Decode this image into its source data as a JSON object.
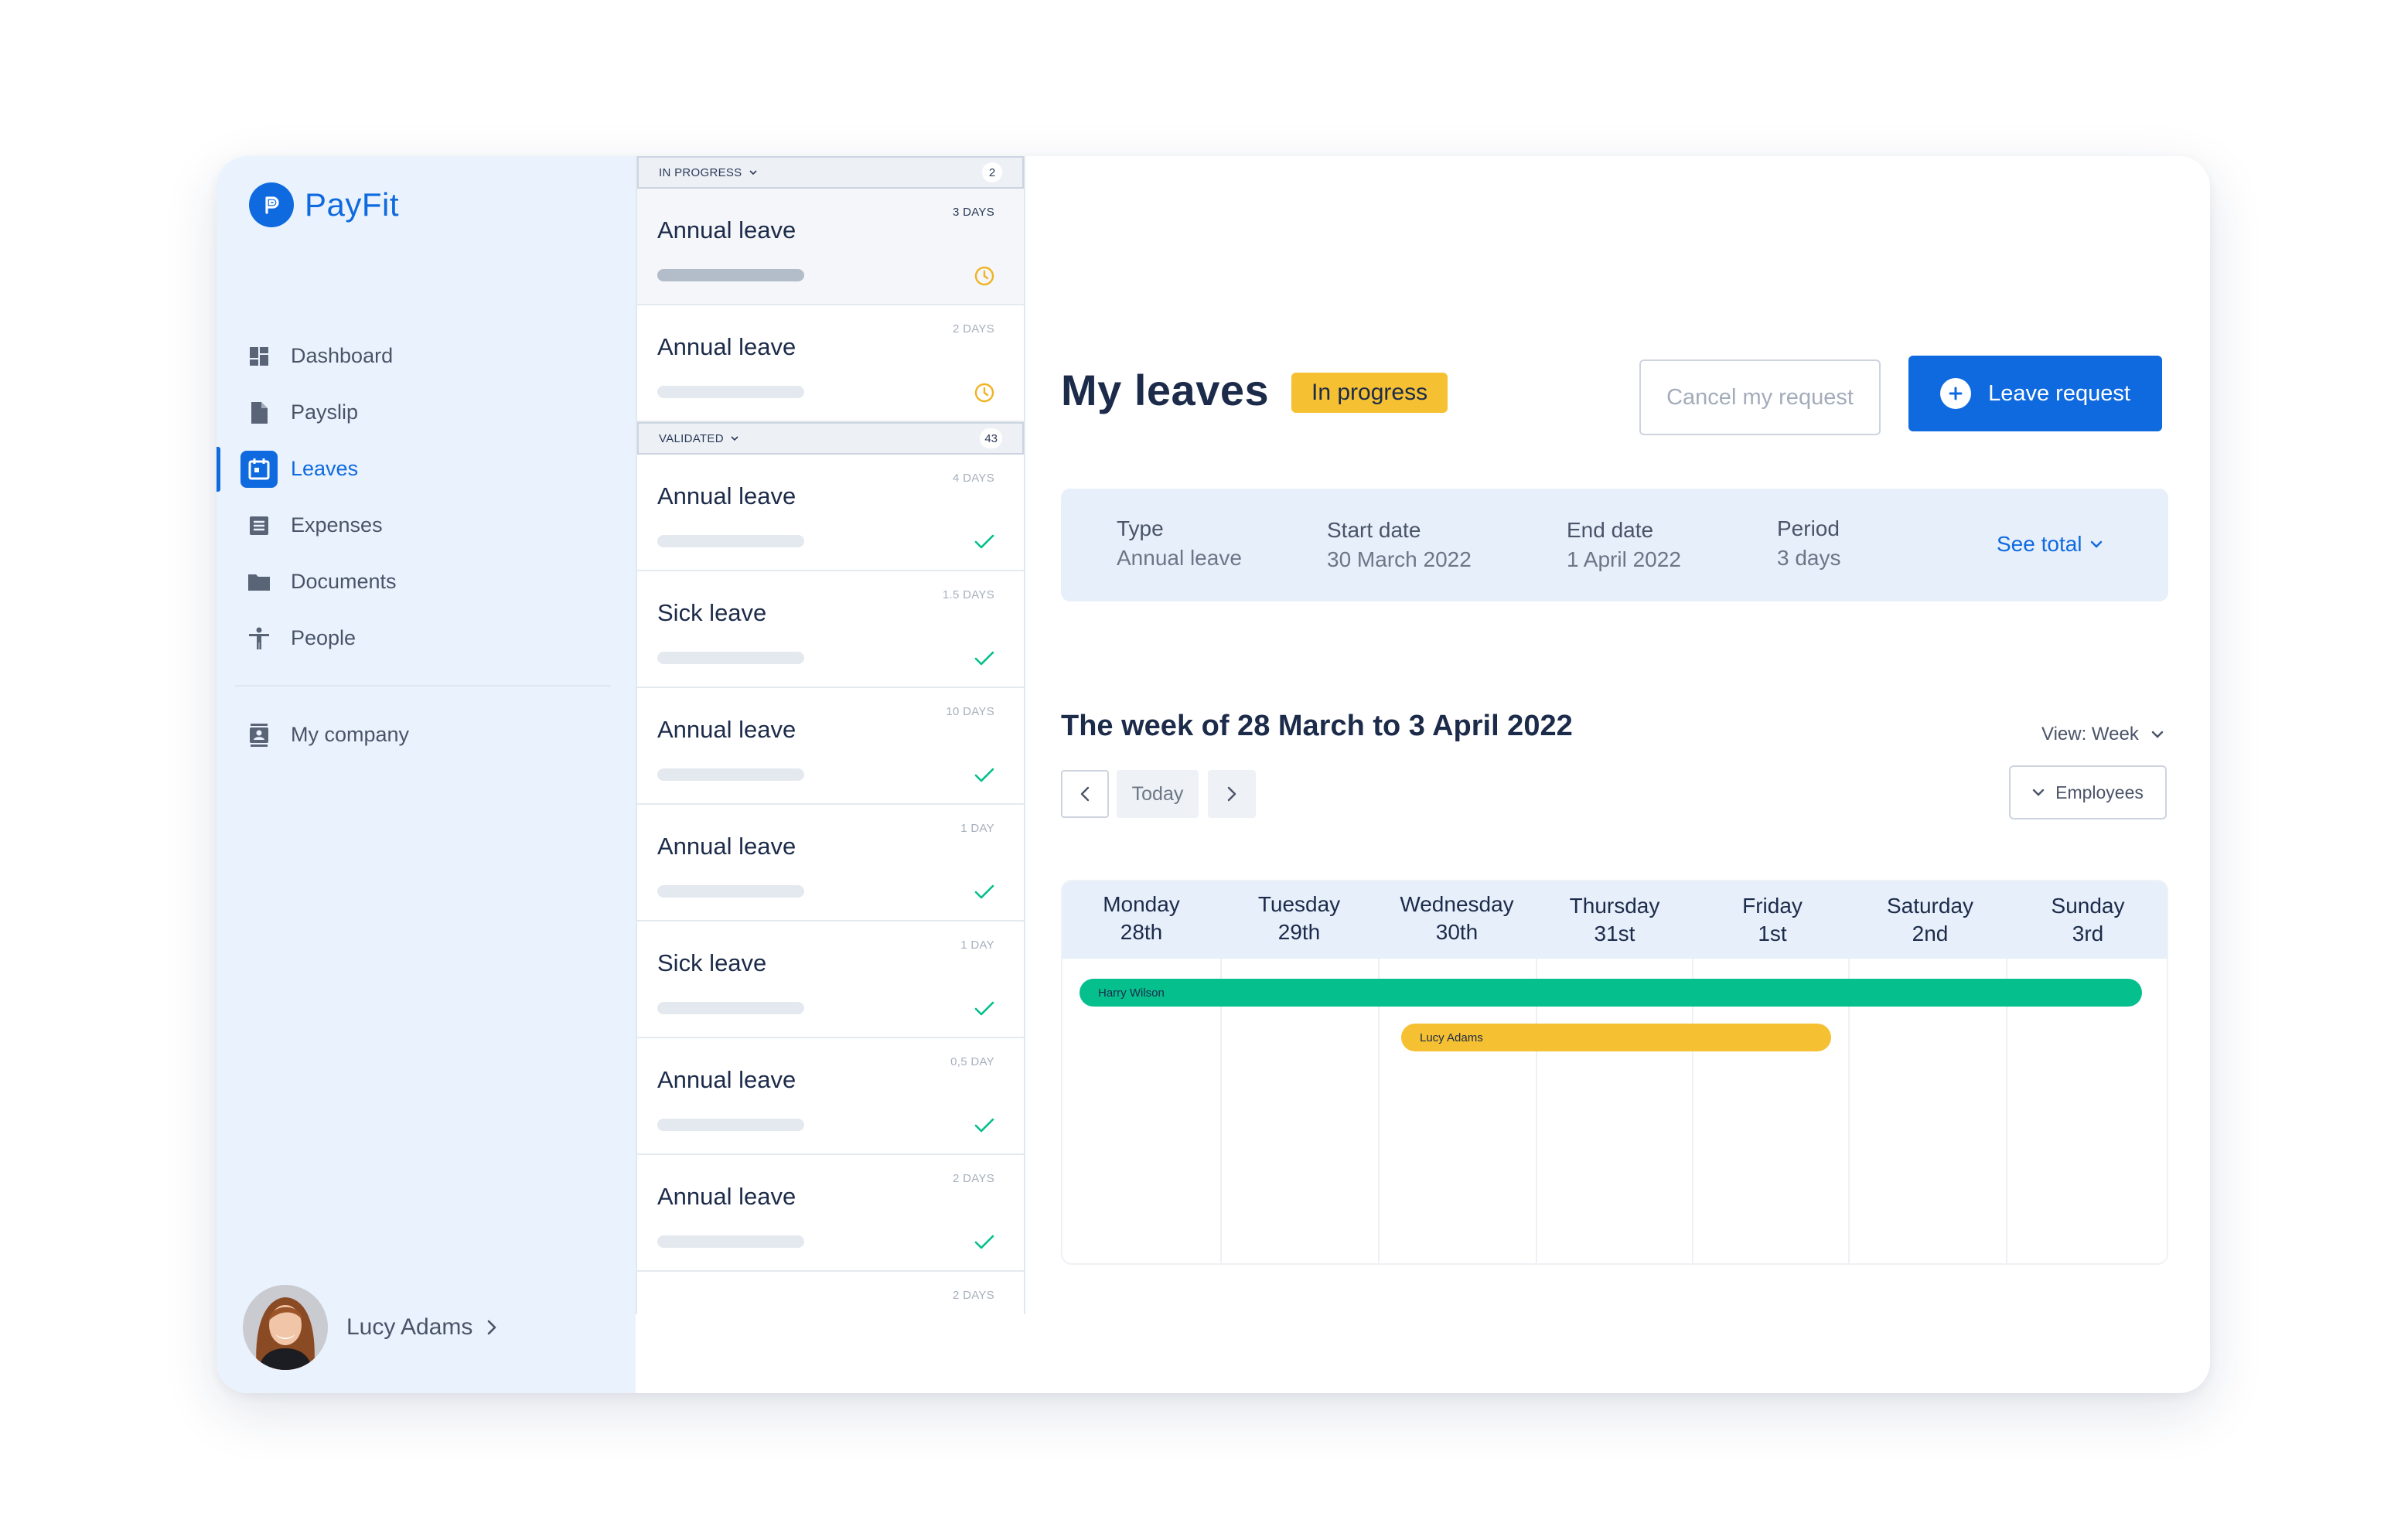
{
  "app": {
    "brand": "PayFit",
    "brand_color": "#0f6ae0"
  },
  "sidebar": {
    "items": [
      {
        "label": "Dashboard",
        "icon": "dashboard-icon"
      },
      {
        "label": "Payslip",
        "icon": "document-icon"
      },
      {
        "label": "Leaves",
        "icon": "calendar-icon",
        "active": true
      },
      {
        "label": "Expenses",
        "icon": "receipt-icon"
      },
      {
        "label": "Documents",
        "icon": "folder-icon"
      },
      {
        "label": "People",
        "icon": "person-icon"
      }
    ],
    "company": {
      "label": "My company",
      "icon": "company-icon"
    },
    "user": {
      "name": "Lucy Adams"
    }
  },
  "leave_list": {
    "in_progress": {
      "label": "IN PROGRESS",
      "count": "2",
      "items": [
        {
          "title": "Annual leave",
          "days": "3 DAYS",
          "status": "pending"
        },
        {
          "title": "Annual leave",
          "days": "2 DAYS",
          "status": "pending"
        }
      ]
    },
    "validated": {
      "label": "VALIDATED",
      "count": "43",
      "items": [
        {
          "title": "Annual leave",
          "days": "4 DAYS",
          "status": "validated"
        },
        {
          "title": "Sick leave",
          "days": "1.5 DAYS",
          "status": "validated"
        },
        {
          "title": "Annual leave",
          "days": "10 DAYS",
          "status": "validated"
        },
        {
          "title": "Annual leave",
          "days": "1 DAY",
          "status": "validated"
        },
        {
          "title": "Sick leave",
          "days": "1 DAY",
          "status": "validated"
        },
        {
          "title": "Annual leave",
          "days": "0,5 DAY",
          "status": "validated"
        },
        {
          "title": "Annual leave",
          "days": "2 DAYS",
          "status": "validated"
        },
        {
          "title": "",
          "days": "2 DAYS",
          "status": ""
        }
      ]
    }
  },
  "main": {
    "title": "My leaves",
    "status_badge": "In progress",
    "cancel_button": "Cancel my request",
    "request_button": "Leave request",
    "summary": {
      "type_label": "Type",
      "type_value": "Annual leave",
      "start_label": "Start date",
      "start_value": "30 March 2022",
      "end_label": "End date",
      "end_value": "1 April 2022",
      "period_label": "Period",
      "period_value": "3 days",
      "see_total": "See total"
    },
    "week_title": "The week of 28 March to 3 April 2022",
    "view_select": "View: Week",
    "today_button": "Today",
    "employees_button": "Employees",
    "calendar": {
      "days": [
        {
          "name": "Monday",
          "date": "28th"
        },
        {
          "name": "Tuesday",
          "date": "29th"
        },
        {
          "name": "Wednesday",
          "date": "30th"
        },
        {
          "name": "Thursday",
          "date": "31st"
        },
        {
          "name": "Friday",
          "date": "1st"
        },
        {
          "name": "Saturday",
          "date": "2nd"
        },
        {
          "name": "Sunday",
          "date": "3rd"
        }
      ],
      "leaves": [
        {
          "employee": "Harry Wilson",
          "color": "#05bf8d"
        },
        {
          "employee": "Lucy Adams",
          "color": "#f5c031"
        }
      ]
    }
  },
  "colors": {
    "accent": "#0f6ae0",
    "pending": "#f5c031",
    "validated": "#05bf8d"
  }
}
